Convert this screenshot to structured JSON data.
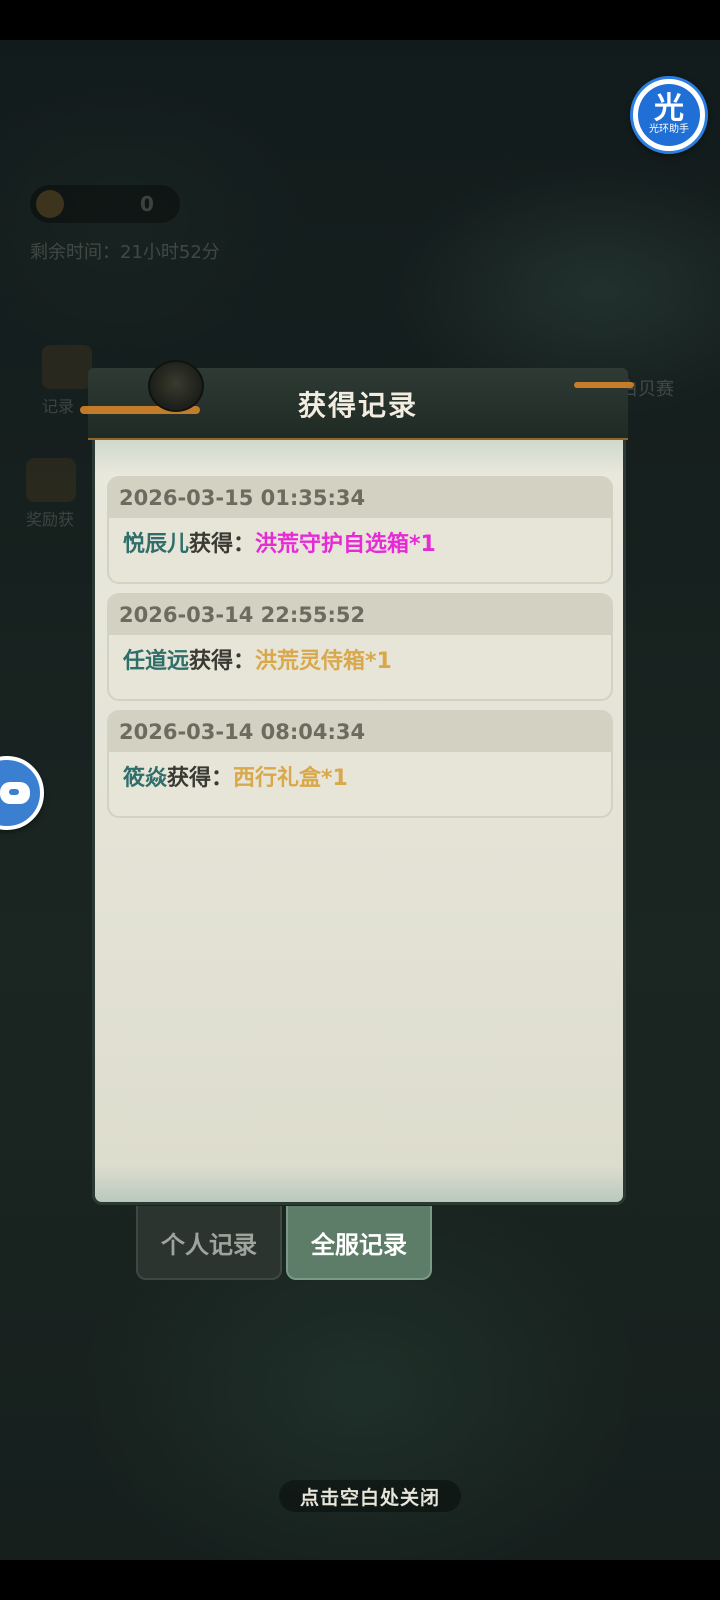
{
  "background": {
    "coin_count": "0",
    "timer": "剩余时间：21小时52分",
    "left_items": [
      "记录",
      "奖励获"
    ],
    "right_item": "白贝赛"
  },
  "halo_assistant": {
    "glyph": "光",
    "label": "光环助手"
  },
  "modal": {
    "title": "获得记录",
    "records": [
      {
        "time": "2026-03-15 01:35:34",
        "player": "悦辰儿",
        "got": "获得：",
        "item": "洪荒守护自选箱*1",
        "item_color": "#e62ad6"
      },
      {
        "time": "2026-03-14 22:55:52",
        "player": "任道远",
        "got": "获得：",
        "item": "洪荒灵侍箱*1",
        "item_color": "#d9a84a"
      },
      {
        "time": "2026-03-14 08:04:34",
        "player": "筱焱",
        "got": "获得：",
        "item": "西行礼盒*1",
        "item_color": "#d9a84a"
      }
    ],
    "tabs": [
      {
        "label": "个人记录",
        "active": false
      },
      {
        "label": "全服记录",
        "active": true
      }
    ]
  },
  "close_hint": "点击空白处关闭"
}
